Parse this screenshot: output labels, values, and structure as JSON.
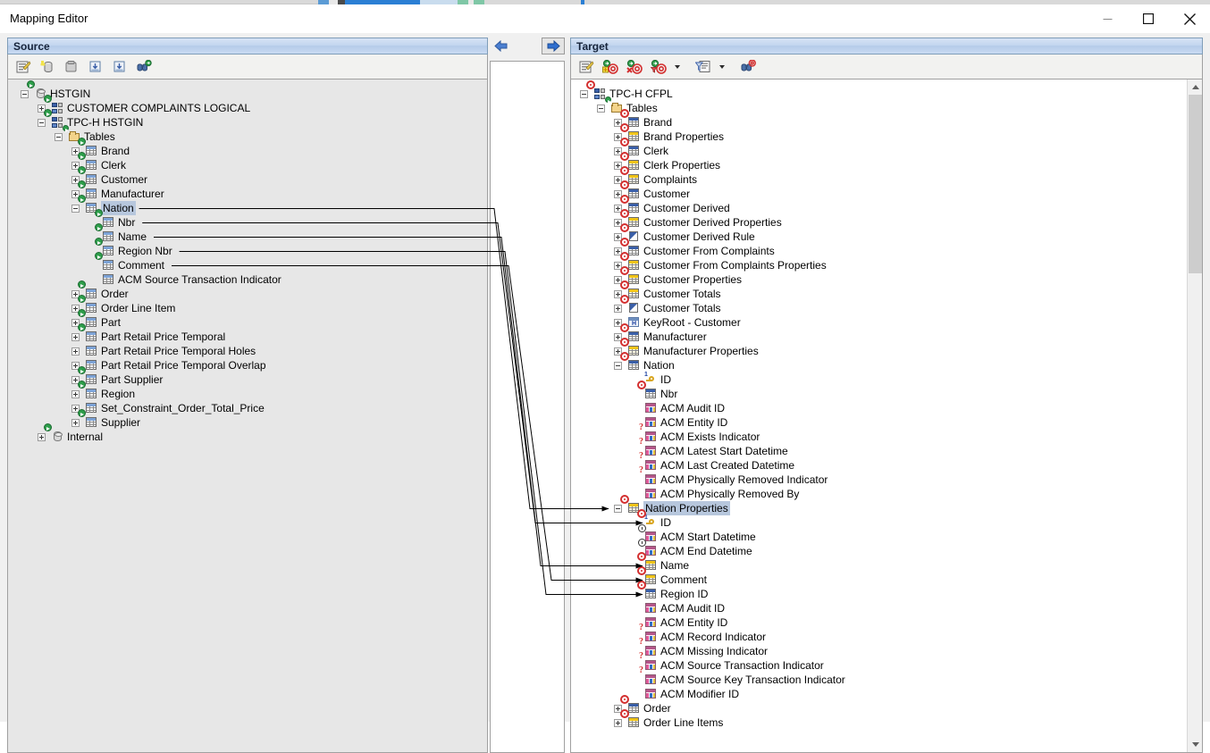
{
  "window": {
    "title": "Mapping Editor",
    "buttons": {
      "minimize": "minimize-icon",
      "maximize": "maximize-icon",
      "close": "close-icon"
    }
  },
  "colors": {
    "header_gradient_start": "#d6e3f5",
    "header_gradient_end": "#b5cbe9",
    "header_border": "#7f9db9",
    "selection": "#b7c7dd",
    "toolbar_bg": "#f2f2f0",
    "source_pane_bg": "#e7e7e7",
    "target_pane_bg": "#ffffff",
    "badge_green": "#2e9e4b",
    "badge_red": "#d32f2f",
    "line": "#000000"
  },
  "source_panel": {
    "header": "Source",
    "toolbar": [
      {
        "name": "properties-icon",
        "glyph": "properties"
      },
      {
        "name": "add-database-icon",
        "glyph": "db-add"
      },
      {
        "name": "remove-object-icon",
        "glyph": "obj-remove"
      },
      {
        "name": "import-icon",
        "glyph": "import"
      },
      {
        "name": "export-icon",
        "glyph": "export"
      },
      {
        "name": "find-icon",
        "glyph": "binoculars-add"
      }
    ],
    "tree": [
      {
        "label": "HSTGIN",
        "depth": 0,
        "expander": "minus",
        "icon": "database-icon"
      },
      {
        "label": "CUSTOMER COMPLAINTS LOGICAL",
        "depth": 1,
        "expander": "plus",
        "icon": "model-icon"
      },
      {
        "label": "TPC-H HSTGIN",
        "depth": 1,
        "expander": "minus",
        "icon": "model-icon"
      },
      {
        "label": "Tables",
        "depth": 2,
        "expander": "minus",
        "icon": "folder-icon"
      },
      {
        "label": "Brand",
        "depth": 3,
        "expander": "plus",
        "icon": "table-source-icon"
      },
      {
        "label": "Clerk",
        "depth": 3,
        "expander": "plus",
        "icon": "table-source-icon"
      },
      {
        "label": "Customer",
        "depth": 3,
        "expander": "plus",
        "icon": "table-source-icon"
      },
      {
        "label": "Manufacturer",
        "depth": 3,
        "expander": "plus",
        "icon": "table-source-icon"
      },
      {
        "label": "Nation",
        "depth": 3,
        "expander": "minus",
        "icon": "table-source-icon",
        "selected": true,
        "mapped": true
      },
      {
        "label": "Nbr",
        "depth": 4,
        "expander": "none",
        "icon": "table-source-icon",
        "mapped": true
      },
      {
        "label": "Name",
        "depth": 4,
        "expander": "none",
        "icon": "table-source-icon",
        "mapped": true
      },
      {
        "label": "Region Nbr",
        "depth": 4,
        "expander": "none",
        "icon": "table-source-icon",
        "mapped": true
      },
      {
        "label": "Comment",
        "depth": 4,
        "expander": "none",
        "icon": "table-source-icon",
        "mapped": true
      },
      {
        "label": "ACM Source Transaction Indicator",
        "depth": 4,
        "expander": "none",
        "icon": "table-plain-icon"
      },
      {
        "label": "Order",
        "depth": 3,
        "expander": "plus",
        "icon": "table-source-icon"
      },
      {
        "label": "Order Line Item",
        "depth": 3,
        "expander": "plus",
        "icon": "table-source-icon"
      },
      {
        "label": "Part",
        "depth": 3,
        "expander": "plus",
        "icon": "table-source-icon"
      },
      {
        "label": "Part Retail Price Temporal",
        "depth": 3,
        "expander": "plus",
        "icon": "table-source-icon"
      },
      {
        "label": "Part Retail Price Temporal Holes",
        "depth": 3,
        "expander": "plus",
        "icon": "table-plain-icon"
      },
      {
        "label": "Part Retail Price Temporal Overlap",
        "depth": 3,
        "expander": "plus",
        "icon": "table-plain-icon"
      },
      {
        "label": "Part Supplier",
        "depth": 3,
        "expander": "plus",
        "icon": "table-source-icon"
      },
      {
        "label": "Region",
        "depth": 3,
        "expander": "plus",
        "icon": "table-source-icon"
      },
      {
        "label": "Set_Constraint_Order_Total_Price",
        "depth": 3,
        "expander": "plus",
        "icon": "table-plain-icon"
      },
      {
        "label": "Supplier",
        "depth": 3,
        "expander": "plus",
        "icon": "table-source-icon"
      },
      {
        "label": "Internal",
        "depth": 1,
        "expander": "plus",
        "icon": "database-icon"
      }
    ]
  },
  "center_panel": {
    "back_button": "previous-mapping-icon",
    "forward_button": "next-mapping-icon"
  },
  "target_panel": {
    "header": "Target",
    "toolbar": [
      {
        "name": "properties-icon",
        "glyph": "properties"
      },
      {
        "name": "add-mapping-icon",
        "glyph": "target-add"
      },
      {
        "name": "delete-mapping-icon",
        "glyph": "target-delete"
      },
      {
        "name": "filter-mapping-icon",
        "glyph": "target-filter"
      },
      {
        "name": "filter-dropdown-caret",
        "glyph": "caret"
      },
      {
        "name": "list-filter-icon",
        "glyph": "list-filter"
      },
      {
        "name": "list-filter-caret",
        "glyph": "caret"
      },
      {
        "name": "find-target-icon",
        "glyph": "binoculars-target"
      }
    ],
    "scrollbar": {
      "up": "scroll-up-icon",
      "down": "scroll-down-icon"
    },
    "tree": [
      {
        "label": "TPC-H CFPL",
        "depth": 0,
        "expander": "minus",
        "icon": "model-target-icon"
      },
      {
        "label": "Tables",
        "depth": 1,
        "expander": "minus",
        "icon": "folder-icon"
      },
      {
        "label": "Brand",
        "depth": 2,
        "expander": "plus",
        "icon": "table-blue-target-icon"
      },
      {
        "label": "Brand Properties",
        "depth": 2,
        "expander": "plus",
        "icon": "table-yellow-target-icon"
      },
      {
        "label": "Clerk",
        "depth": 2,
        "expander": "plus",
        "icon": "table-blue-target-icon"
      },
      {
        "label": "Clerk Properties",
        "depth": 2,
        "expander": "plus",
        "icon": "table-yellow-target-icon"
      },
      {
        "label": "Complaints",
        "depth": 2,
        "expander": "plus",
        "icon": "table-yellow-target-icon"
      },
      {
        "label": "Customer",
        "depth": 2,
        "expander": "plus",
        "icon": "table-blue-target-icon"
      },
      {
        "label": "Customer Derived",
        "depth": 2,
        "expander": "plus",
        "icon": "table-blue-target-icon"
      },
      {
        "label": "Customer Derived Properties",
        "depth": 2,
        "expander": "plus",
        "icon": "table-yellow-target-icon"
      },
      {
        "label": "Customer Derived Rule",
        "depth": 2,
        "expander": "plus",
        "icon": "rule-target-icon"
      },
      {
        "label": "Customer From Complaints",
        "depth": 2,
        "expander": "plus",
        "icon": "table-blue-target-icon"
      },
      {
        "label": "Customer From Complaints Properties",
        "depth": 2,
        "expander": "plus",
        "icon": "table-yellow-target-icon"
      },
      {
        "label": "Customer Properties",
        "depth": 2,
        "expander": "plus",
        "icon": "table-yellow-target-icon"
      },
      {
        "label": "Customer Totals",
        "depth": 2,
        "expander": "plus",
        "icon": "table-yellow-target-icon"
      },
      {
        "label": "Customer Totals",
        "depth": 2,
        "expander": "plus",
        "icon": "rule-target-icon"
      },
      {
        "label": "KeyRoot - Customer",
        "depth": 2,
        "expander": "plus",
        "icon": "keyroot-icon"
      },
      {
        "label": "Manufacturer",
        "depth": 2,
        "expander": "plus",
        "icon": "table-blue-target-icon"
      },
      {
        "label": "Manufacturer Properties",
        "depth": 2,
        "expander": "plus",
        "icon": "table-yellow-target-icon"
      },
      {
        "label": "Nation",
        "depth": 2,
        "expander": "minus",
        "icon": "table-blue-target-icon"
      },
      {
        "label": "ID",
        "depth": 3,
        "expander": "none",
        "icon": "key-icon"
      },
      {
        "label": "Nbr",
        "depth": 3,
        "expander": "none",
        "icon": "table-blue-target-icon"
      },
      {
        "label": "ACM Audit ID",
        "depth": 3,
        "expander": "none",
        "icon": "column-icon"
      },
      {
        "label": "ACM Entity ID",
        "depth": 3,
        "expander": "none",
        "icon": "column-icon"
      },
      {
        "label": "ACM Exists Indicator",
        "depth": 3,
        "expander": "none",
        "icon": "column-question-icon"
      },
      {
        "label": "ACM Latest Start Datetime",
        "depth": 3,
        "expander": "none",
        "icon": "column-question-icon"
      },
      {
        "label": "ACM Last Created Datetime",
        "depth": 3,
        "expander": "none",
        "icon": "column-question-icon"
      },
      {
        "label": "ACM Physically Removed Indicator",
        "depth": 3,
        "expander": "none",
        "icon": "column-question-icon"
      },
      {
        "label": "ACM Physically Removed By",
        "depth": 3,
        "expander": "none",
        "icon": "column-icon"
      },
      {
        "label": "Nation Properties",
        "depth": 2,
        "expander": "minus",
        "icon": "table-yellow-target-icon",
        "selected": true,
        "mapped": true
      },
      {
        "label": "ID",
        "depth": 3,
        "expander": "none",
        "icon": "key-target-icon",
        "mapped": true
      },
      {
        "label": "ACM Start Datetime",
        "depth": 3,
        "expander": "none",
        "icon": "column-clock-icon"
      },
      {
        "label": "ACM End Datetime",
        "depth": 3,
        "expander": "none",
        "icon": "column-clock-icon"
      },
      {
        "label": "Name",
        "depth": 3,
        "expander": "none",
        "icon": "table-yellow-target-icon",
        "mapped": true
      },
      {
        "label": "Comment",
        "depth": 3,
        "expander": "none",
        "icon": "table-yellow-target-icon",
        "mapped": true
      },
      {
        "label": "Region ID",
        "depth": 3,
        "expander": "none",
        "icon": "table-blue-target-icon",
        "mapped": true
      },
      {
        "label": "ACM Audit ID",
        "depth": 3,
        "expander": "none",
        "icon": "column-icon"
      },
      {
        "label": "ACM Entity ID",
        "depth": 3,
        "expander": "none",
        "icon": "column-icon"
      },
      {
        "label": "ACM Record Indicator",
        "depth": 3,
        "expander": "none",
        "icon": "column-question-icon"
      },
      {
        "label": "ACM Missing Indicator",
        "depth": 3,
        "expander": "none",
        "icon": "column-question-icon"
      },
      {
        "label": "ACM Source Transaction Indicator",
        "depth": 3,
        "expander": "none",
        "icon": "column-question-icon"
      },
      {
        "label": "ACM Source Key Transaction Indicator",
        "depth": 3,
        "expander": "none",
        "icon": "column-question-icon"
      },
      {
        "label": "ACM Modifier ID",
        "depth": 3,
        "expander": "none",
        "icon": "column-icon"
      },
      {
        "label": "Order",
        "depth": 2,
        "expander": "plus",
        "icon": "table-blue-target-icon"
      },
      {
        "label": "Order Line Items",
        "depth": 2,
        "expander": "plus",
        "icon": "table-yellow-target-icon"
      }
    ]
  },
  "mappings": [
    {
      "source": "Nation",
      "target": "Nation Properties"
    },
    {
      "source": "Nbr",
      "target": "ID"
    },
    {
      "source": "Name",
      "target": "Name"
    },
    {
      "source": "Region Nbr",
      "target": "Region ID"
    },
    {
      "source": "Comment",
      "target": "Comment"
    }
  ]
}
